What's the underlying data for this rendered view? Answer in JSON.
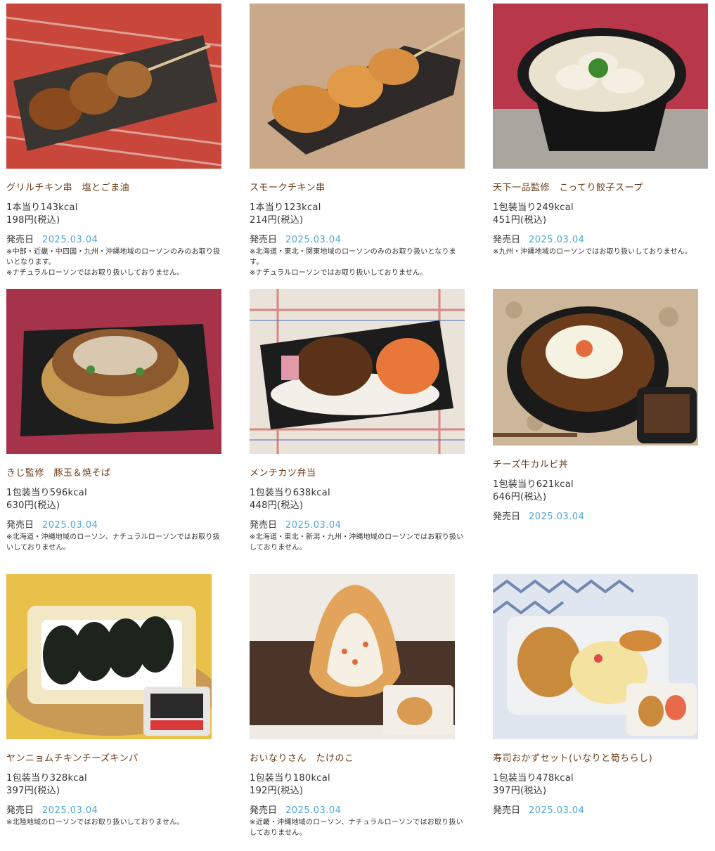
{
  "release_label": "発売日",
  "products": [
    {
      "name": "グリルチキン串　塩とごま油",
      "kcal": "1本当り143kcal",
      "price": "198円(税込)",
      "date": "2025.03.04",
      "notes": [
        "※中部・近畿・中四国・九州・沖縄地域のローソンのみのお取り扱いとなります。",
        "※ナチュラルローソンではお取り扱いしておりません。"
      ],
      "image": "grilled-chicken-skewer-photo",
      "bg": "#c8473a"
    },
    {
      "name": "スモークチキン串",
      "kcal": "1本当り123kcal",
      "price": "214円(税込)",
      "date": "2025.03.04",
      "notes": [
        "※北海道・東北・関東地域のローソンのみのお取り扱いとなります。",
        "※ナチュラルローソンではお取り扱いしておりません。"
      ],
      "image": "smoked-chicken-skewer-photo",
      "bg": "#c9a98a"
    },
    {
      "name": "天下一品監修　こってり餃子スープ",
      "kcal": "1包装当り249kcal",
      "price": "451円(税込)",
      "date": "2025.03.04",
      "notes": [
        "※九州・沖縄地域のローソンではお取り扱いしておりません。"
      ],
      "image": "dumpling-soup-photo",
      "bg": "#b8374a"
    },
    {
      "name": "きじ監修　豚玉＆焼そば",
      "kcal": "1包装当り596kcal",
      "price": "630円(税込)",
      "date": "2025.03.04",
      "notes": [
        "※北海道・沖縄地域のローソン、ナチュラルローソンではお取り扱いしておりません。"
      ],
      "image": "okonomiyaki-yakisoba-photo",
      "bg": "#a6334a"
    },
    {
      "name": "メンチカツ弁当",
      "kcal": "1包装当り638kcal",
      "price": "448円(税込)",
      "date": "2025.03.04",
      "notes": [
        "※北海道・東北・新潟・九州・沖縄地域のローソンではお取り扱いしておりません。"
      ],
      "image": "menchikatsu-bento-photo",
      "bg": "#e9e3da"
    },
    {
      "name": "チーズ牛カルビ丼",
      "kcal": "1包装当り621kcal",
      "price": "646円(税込)",
      "date": "2025.03.04",
      "notes": [],
      "image": "cheese-beef-kalbi-bowl-photo",
      "bg": "#cdb79a"
    },
    {
      "name": "ヤンニョムチキンチーズキンパ",
      "kcal": "1包装当り328kcal",
      "price": "397円(税込)",
      "date": "2025.03.04",
      "notes": [
        "※北陸地域のローソンではお取り扱いしておりません。"
      ],
      "image": "yangnyeom-kimbap-photo",
      "bg": "#e9c04a"
    },
    {
      "name": "おいなりさん　たけのこ",
      "kcal": "1包装当り180kcal",
      "price": "192円(税込)",
      "date": "2025.03.04",
      "notes": [
        "※近畿・沖縄地域のローソン、ナチュラルローソンではお取り扱いしておりません。"
      ],
      "image": "inari-takenoko-photo",
      "bg": "#efeae4"
    },
    {
      "name": "寿司おかずセット(いなりと筍ちらし)",
      "kcal": "1包装当り478kcal",
      "price": "397円(税込)",
      "date": "2025.03.04",
      "notes": [],
      "image": "sushi-okazu-set-photo",
      "bg": "#dfe6ef"
    }
  ]
}
